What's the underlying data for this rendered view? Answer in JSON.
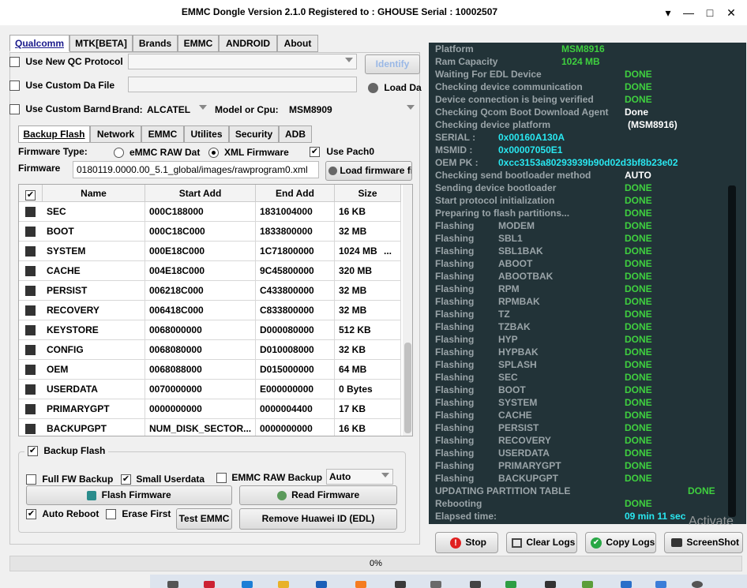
{
  "window": {
    "title": "EMMC Dongle Version 2.1.0 Registered to : GHOUSE   Serial : 10002507",
    "menu_arrow": "▾",
    "minimize": "—",
    "maximize": "□",
    "close": "✕"
  },
  "main_tabs": [
    "Qualcomm",
    "MTK[BETA]",
    "Brands",
    "EMMC",
    "ANDROID",
    "About"
  ],
  "qualcomm": {
    "use_new_qc_protocol": "Use New QC Protocol",
    "use_custom_da_file": "Use Custom Da File",
    "use_custom_brand": "Use Custom Barnd",
    "brand_label": "Brand:",
    "brand_value": "ALCATEL",
    "model_label": "Model or Cpu:",
    "model_value": "MSM8909",
    "identify_button": "Identify",
    "load_da_button": "Load Da"
  },
  "sub_tabs": [
    "Backup  Flash",
    "Network",
    "EMMC",
    "Utilites",
    "Security",
    "ADB"
  ],
  "firmware": {
    "type_label": "Firmware Type:",
    "emmc_raw": "eMMC RAW Dat",
    "xml_firmware": "XML Firmware",
    "use_patch": "Use Pach0",
    "firmware_label": "Firmware",
    "firmware_path": "0180119.0000.00_5.1_global/images/rawprogram0.xml",
    "load_firmware_button": "Load firmware fi"
  },
  "table": {
    "headers": [
      "Name",
      "Start Add",
      "End Add",
      "Size"
    ],
    "rows": [
      [
        "SEC",
        "000C188000",
        "1831004000",
        "16 KB"
      ],
      [
        "BOOT",
        "000C18C000",
        "1833800000",
        "32 MB"
      ],
      [
        "SYSTEM",
        "000E18C000",
        "1C71800000",
        "1024 MB"
      ],
      [
        "CACHE",
        "004E18C000",
        "9C45800000",
        "320 MB"
      ],
      [
        "PERSIST",
        "006218C000",
        "C433800000",
        "32 MB"
      ],
      [
        "RECOVERY",
        "006418C000",
        "C833800000",
        "32 MB"
      ],
      [
        "KEYSTORE",
        "0068000000",
        "D000080000",
        "512 KB"
      ],
      [
        "CONFIG",
        "0068080000",
        "D010008000",
        "32 KB"
      ],
      [
        "OEM",
        "0068088000",
        "D015000000",
        "64 MB"
      ],
      [
        "USERDATA",
        "0070000000",
        "E000000000",
        "0 Bytes"
      ],
      [
        "PRIMARYGPT",
        "0000000000",
        "0000004400",
        "17 KB"
      ],
      [
        "BACKUPGPT",
        "NUM_DISK_SECTOR...",
        "0000000000",
        "16 KB"
      ]
    ],
    "ellipsis": "..."
  },
  "backup_flash": {
    "group_title": "Backup  Flash",
    "full_fw_backup": "Full FW Backup",
    "small_userdata": "Small Userdata",
    "emmc_raw_backup": "EMMC RAW Backup",
    "mode_value": "Auto",
    "flash_firmware": "Flash Firmware",
    "read_firmware": "Read Firmware",
    "auto_reboot": "Auto Reboot",
    "erase_first": "Erase First",
    "test_emmc": "Test EMMC",
    "remove_huawei_id": "Remove Huawei ID (EDL)"
  },
  "log": {
    "platform_label": "Platform",
    "platform_value": "MSM8916",
    "ram_label": "Ram Capacity",
    "ram_value": "1024 MB",
    "status_lines": [
      [
        "Waiting For EDL Device",
        "DONE"
      ],
      [
        "Checking device communication",
        "DONE"
      ],
      [
        "Device connection is being verified",
        "DONE"
      ],
      [
        "Checking Qcom Boot Download Agent",
        "Done"
      ],
      [
        "Checking device platform",
        "(MSM8916)"
      ]
    ],
    "serial_label": "SERIAL :",
    "serial_value": "0x00160A130A",
    "msmid_label": "MSMID :",
    "msmid_value": "0x00007050E1",
    "oempk_label": "OEM PK :",
    "oempk_value": "0xcc3153a80293939b90d02d3bf8b23e02",
    "status_lines2": [
      [
        "Checking send bootloader method",
        "AUTO"
      ],
      [
        "Sending device bootloader",
        "DONE"
      ],
      [
        "Start protocol initialization",
        "DONE"
      ],
      [
        "Preparing to flash partitions...",
        "DONE"
      ]
    ],
    "flashing_label": "Flashing",
    "flash_partitions": [
      "MODEM",
      "SBL1",
      "SBL1BAK",
      "ABOOT",
      "ABOOTBAK",
      "RPM",
      "RPMBAK",
      "TZ",
      "TZBAK",
      "HYP",
      "HYPBAK",
      "SPLASH",
      "SEC",
      "BOOT",
      "SYSTEM",
      "CACHE",
      "PERSIST",
      "RECOVERY",
      "USERDATA",
      "PRIMARYGPT",
      "BACKUPGPT"
    ],
    "done": "DONE",
    "updating_label": "UPDATING PARTITION TABLE",
    "rebooting_label": "Rebooting",
    "elapsed_label": "Elapsed time:",
    "elapsed_value": "09 min  11 sec"
  },
  "log_buttons": {
    "stop": "Stop",
    "clear_logs": "Clear Logs",
    "copy_logs": "Copy Logs",
    "screenshot": "ScreenShot"
  },
  "watermark": "Activate",
  "progress": {
    "percent": 0,
    "label": "0%"
  }
}
